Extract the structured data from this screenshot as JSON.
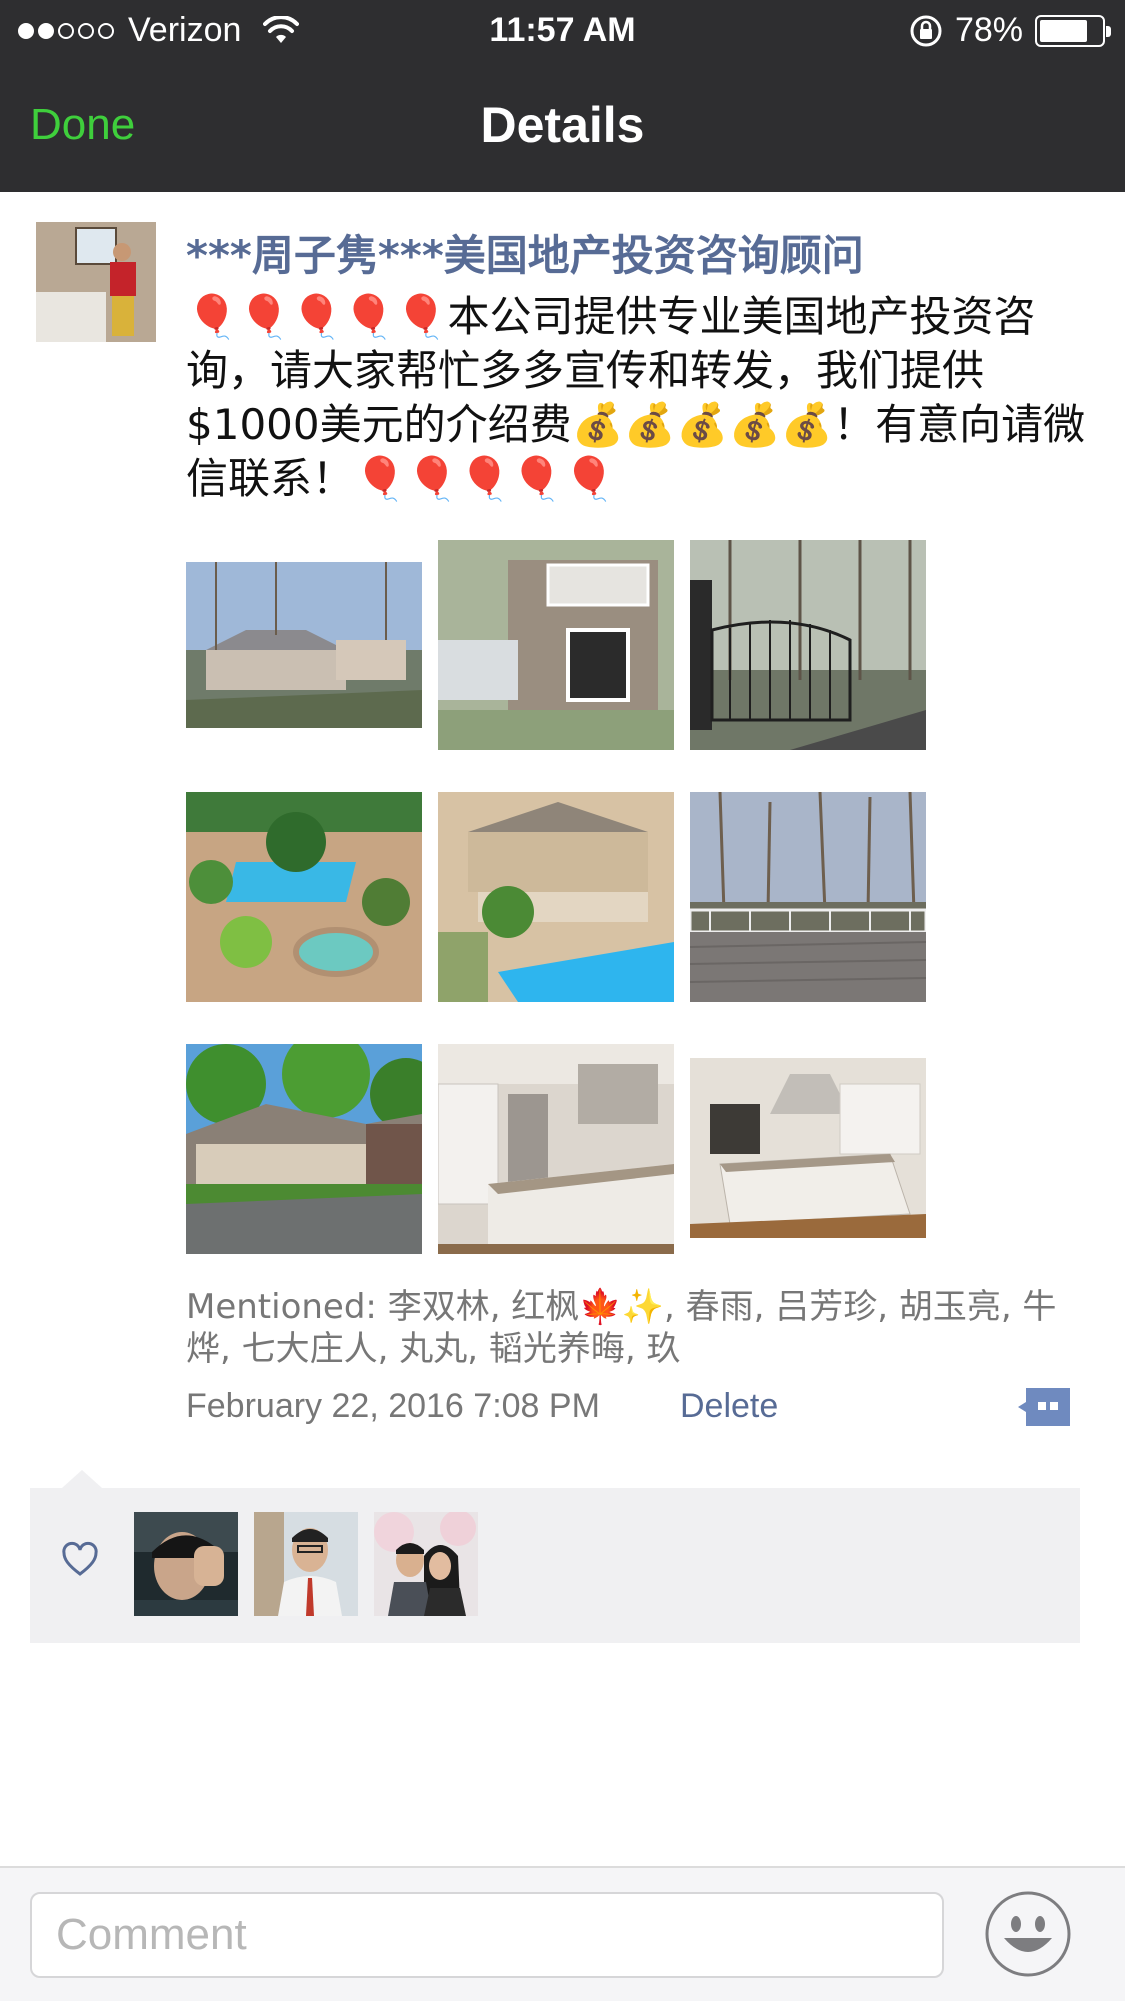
{
  "status_bar": {
    "carrier": "Verizon",
    "time": "11:57 AM",
    "battery_percent": "78%",
    "battery_level": 0.78,
    "signal_bars_filled": 2,
    "signal_bars_total": 5
  },
  "nav": {
    "done_label": "Done",
    "title": "Details"
  },
  "post": {
    "author": "***周子隽***美国地产投资咨询顾问",
    "text": "🎈🎈🎈🎈🎈本公司提供专业美国地产投资咨询，请大家帮忙多多宣传和转发，我们提供$1000美元的介绍费💰💰💰💰💰！有意向请微信联系！🎈🎈🎈🎈🎈",
    "photos": [
      {
        "icon": "house-exterior-photo"
      },
      {
        "icon": "stone-house-photo"
      },
      {
        "icon": "iron-gate-photo"
      },
      {
        "icon": "pool-garden-photo"
      },
      {
        "icon": "pool-house-photo"
      },
      {
        "icon": "wood-deck-photo"
      },
      {
        "icon": "house-driveway-photo"
      },
      {
        "icon": "kitchen-photo"
      },
      {
        "icon": "kitchen-island-photo"
      }
    ],
    "mentioned": "Mentioned: 李双林, 红枫🍁✨, 春雨, 吕芳珍, 胡玉亮, 牛烨, 七大庄人, 丸丸, 韬光养晦, 玖",
    "timestamp": "February 22, 2016 7:08 PM",
    "delete_label": "Delete"
  },
  "likes": {
    "icon": "heart-icon",
    "avatars": [
      "liker-avatar-1",
      "liker-avatar-2",
      "liker-avatar-3"
    ]
  },
  "comment_bar": {
    "placeholder": "Comment",
    "emoji_icon": "smiley-icon"
  },
  "colors": {
    "bar_bg": "#2e2e30",
    "accent_green": "#3fcf3c",
    "link_blue": "#576b95",
    "meta_gray": "#777777",
    "likes_bg": "#f0f0f2"
  }
}
